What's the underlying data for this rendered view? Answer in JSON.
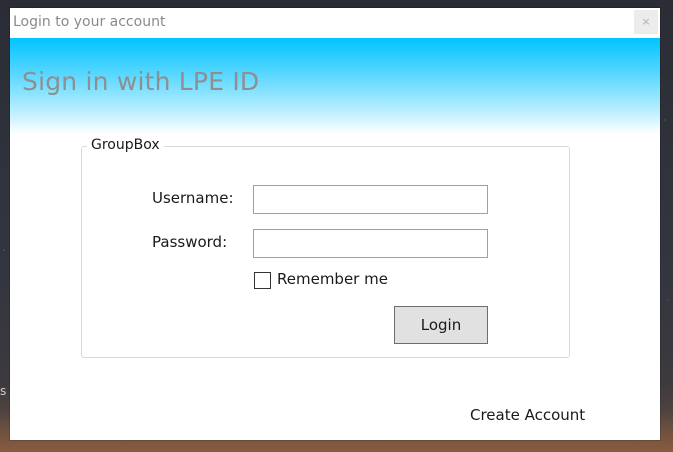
{
  "window": {
    "title": "Login to your account",
    "close_glyph": "×"
  },
  "banner": {
    "heading": "Sign in with LPE ID"
  },
  "form": {
    "groupbox_label": "GroupBox",
    "username_label": "Username:",
    "username_value": "",
    "password_label": "Password:",
    "password_value": "",
    "remember_label": "Remember me",
    "remember_checked": false,
    "login_label": "Login"
  },
  "footer": {
    "create_account_label": "Create Account"
  },
  "desktop": {
    "edge_text": "s"
  },
  "colors": {
    "banner_top": "#00c4ff",
    "banner_bottom": "#ffffff",
    "heading_text": "#8f8f8f",
    "button_face": "#e1e1e1"
  },
  "icons": {
    "close": "close-icon",
    "checkbox": "checkbox-icon"
  }
}
